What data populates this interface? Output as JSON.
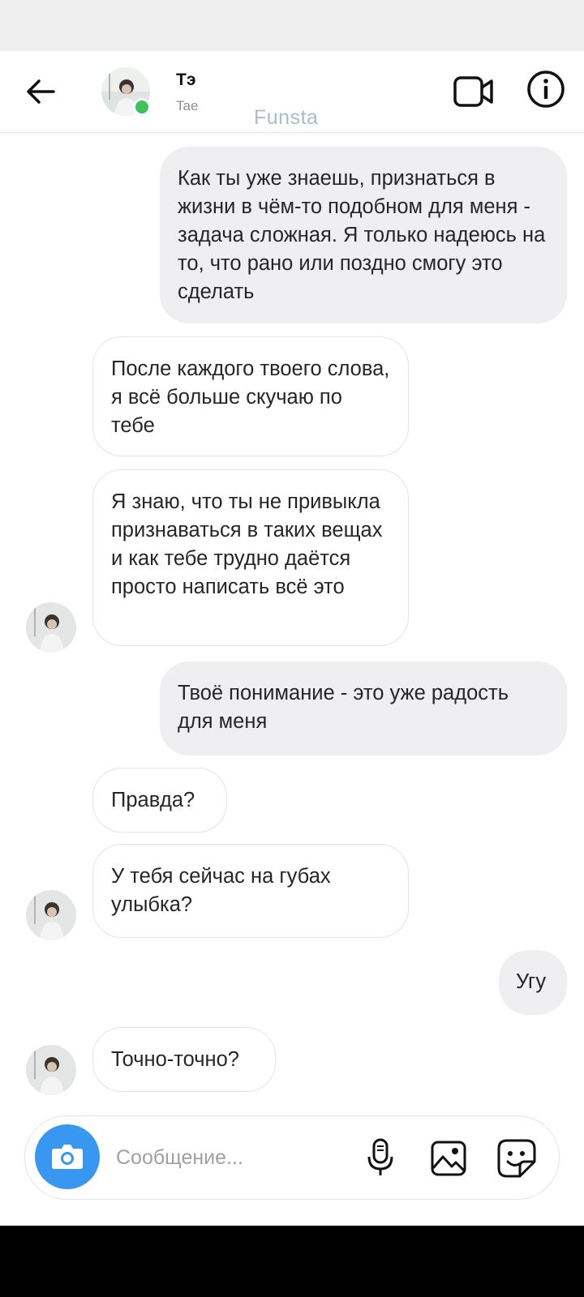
{
  "header": {
    "name": "Тэ",
    "username": "Tae",
    "watermark": "Funsta"
  },
  "messages": [
    {
      "side": "out",
      "text": "Как ты уже знаешь, признаться в жизни в чём-то подобном для меня - задача сложная. Я только надеюсь на то, что рано или поздно смогу это сделать"
    },
    {
      "side": "in",
      "text": "После каждого твоего слова, я всё больше скучаю по тебе"
    },
    {
      "side": "in",
      "text": "Я знаю, что ты не привыкла признаваться в таких вещах и как тебе трудно даётся просто написать всё это"
    },
    {
      "side": "out",
      "text": "Твоё понимание - это уже радость для меня"
    },
    {
      "side": "in",
      "text": "Правда?"
    },
    {
      "side": "in",
      "text": "У тебя сейчас на губах улыбка?"
    },
    {
      "side": "out",
      "text": "Угу"
    },
    {
      "side": "in",
      "text": "Точно-точно?"
    }
  ],
  "composer": {
    "placeholder": "Сообщение..."
  },
  "colors": {
    "accent": "#3897f0",
    "online": "#3ec25a",
    "outgoing_bubble": "#efeff2"
  }
}
